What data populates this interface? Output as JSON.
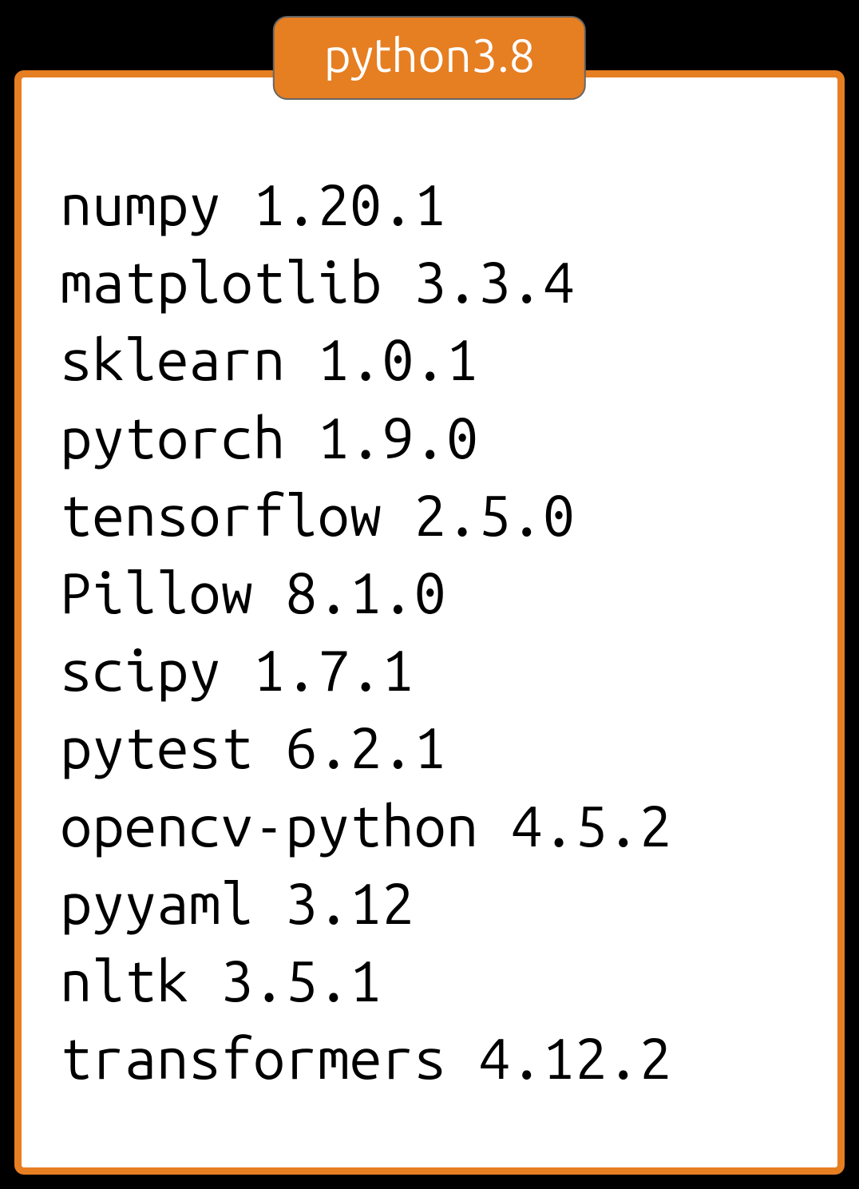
{
  "title": "python3.8",
  "packages": [
    {
      "name": "numpy",
      "version": "1.20.1"
    },
    {
      "name": "matplotlib",
      "version": "3.3.4"
    },
    {
      "name": "sklearn",
      "version": "1.0.1"
    },
    {
      "name": "pytorch",
      "version": "1.9.0"
    },
    {
      "name": "tensorflow",
      "version": "2.5.0"
    },
    {
      "name": "Pillow",
      "version": "8.1.0"
    },
    {
      "name": "scipy",
      "version": "1.7.1"
    },
    {
      "name": "pytest",
      "version": "6.2.1"
    },
    {
      "name": "opencv-python",
      "version": "4.5.2"
    },
    {
      "name": "pyyaml",
      "version": "3.12"
    },
    {
      "name": "nltk",
      "version": "3.5.1"
    },
    {
      "name": "transformers",
      "version": "4.12.2"
    }
  ]
}
